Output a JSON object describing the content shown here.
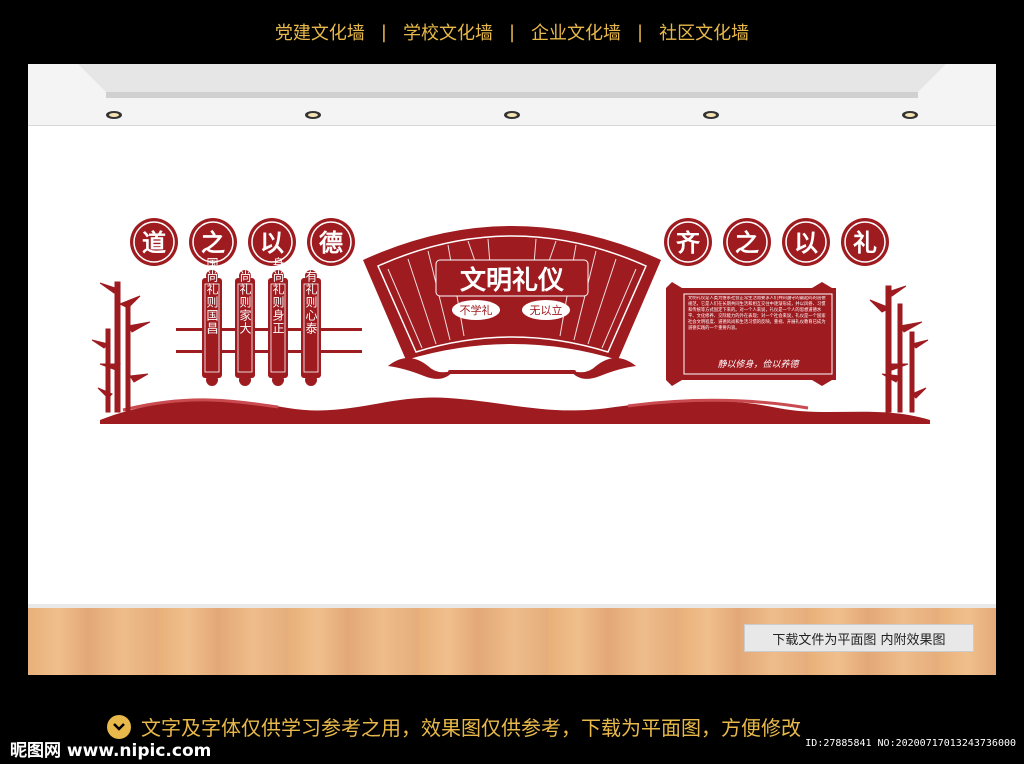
{
  "nav": {
    "items": [
      "党建文化墙",
      "学校文化墙",
      "企业文化墙",
      "社区文化墙"
    ],
    "separator": "|"
  },
  "wall": {
    "left_circles": [
      "道",
      "之",
      "以",
      "德"
    ],
    "right_circles": [
      "齐",
      "之",
      "以",
      "礼"
    ],
    "scrolls": [
      "国尚礼则国昌",
      "家尚礼则家大",
      "身尚礼则身正",
      "心有礼则心泰"
    ],
    "fan_title": "文明礼仪",
    "fan_subtitle_left": "不学礼",
    "fan_subtitle_right": "无以立",
    "plaque_body": "文明礼仪是人类为维系社会正常生活而要求人们共同遵守的最起码的道德规范，它是人们在长期共同生活和相互交往中逐渐形成，并以风俗、习惯和传统等方式固定下来的。对一个人来说，礼仪是一个人的思想道德水平、文化修养、交际能力的外在表现；对一个社会来说，礼仪是一个国家社会文明程度、道德风尚和生活习惯的反映。重视、开展礼仪教育已成为道德实践的一个重要内容。",
    "plaque_motto": "静以修身，俭以养德"
  },
  "caption": "下载文件为平面图  内附效果图",
  "notice": "文字及字体仅供学习参考之用，效果图仅供参考，下载为平面图，方便修改",
  "footer": {
    "logo": "昵图网 www.nipic.com",
    "id": "ID:27885841 NO:20200717013243736000"
  },
  "colors": {
    "accent": "#9e1b20",
    "nav_text": "#e8b94a",
    "background": "#000000"
  }
}
